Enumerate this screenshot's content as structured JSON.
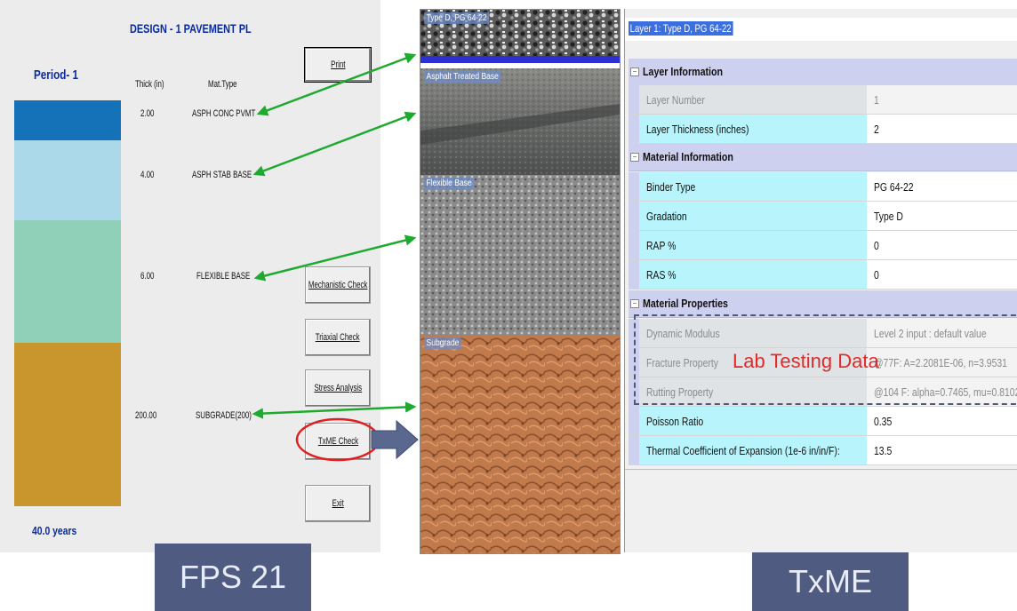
{
  "fps": {
    "title": "DESIGN -  1   PAVEMENT PL",
    "period": "Period- 1",
    "thick_header": "Thick (in)",
    "mat_header": "Mat.Type",
    "duration": "40.0 years",
    "layers": [
      {
        "thickness": "2.00",
        "material": "ASPH CONC PVMT",
        "color": "#1672b8"
      },
      {
        "thickness": "4.00",
        "material": "ASPH STAB BASE",
        "color": "#acd9ea"
      },
      {
        "thickness": "6.00",
        "material": "FLEXIBLE BASE",
        "color": "#90d0b8"
      },
      {
        "thickness": "200.00",
        "material": "SUBGRADE(200)",
        "color": "#c9962e"
      }
    ],
    "buttons": {
      "print": "Print",
      "mechanistic": "Mechanistic Check",
      "triaxial": "Triaxial Check",
      "stress": "Stress Analysis",
      "txme": "TxME Check",
      "exit": "Exit"
    }
  },
  "images": {
    "labels": [
      "Type D, PG 64-22",
      "Asphalt Treated Base",
      "Flexible Base",
      "Subgrade"
    ]
  },
  "txme": {
    "header": "Layer 1: Type D, PG 64-22",
    "sections": {
      "layer_info": "Layer Information",
      "material_info": "Material Information",
      "material_props": "Material Properties"
    },
    "rows": {
      "layer_number": {
        "key": "Layer Number",
        "value": "1"
      },
      "layer_thickness": {
        "key": "Layer Thickness (inches)",
        "value": "2"
      },
      "binder": {
        "key": "Binder Type",
        "value": "PG 64-22"
      },
      "gradation": {
        "key": "Gradation",
        "value": "Type D"
      },
      "rap": {
        "key": "RAP %",
        "value": "0"
      },
      "ras": {
        "key": "RAS %",
        "value": "0"
      },
      "dynamic": {
        "key": "Dynamic Modulus",
        "value": "Level 2 input : default value"
      },
      "fracture": {
        "key": "Fracture Property",
        "value": "@77F: A=2.2081E-06, n=3.9531"
      },
      "rutting": {
        "key": "Rutting Property",
        "value": "@104 F: alpha=0.7465, mu=0.8102"
      },
      "poisson": {
        "key": "Poisson Ratio",
        "value": "0.35"
      },
      "thermal": {
        "key": "Thermal Coefficient of Expansion (1e-6 in/in/F):",
        "value": "13.5"
      }
    },
    "lab_label": "Lab Testing Data"
  },
  "captions": {
    "fps": "FPS 21",
    "txme": "TxME"
  },
  "colors": {
    "arrow": "#1eaa2e",
    "highlight_circle": "#e02020",
    "caption_bg": "#4f5b80",
    "lab_text": "#e02a2a"
  }
}
